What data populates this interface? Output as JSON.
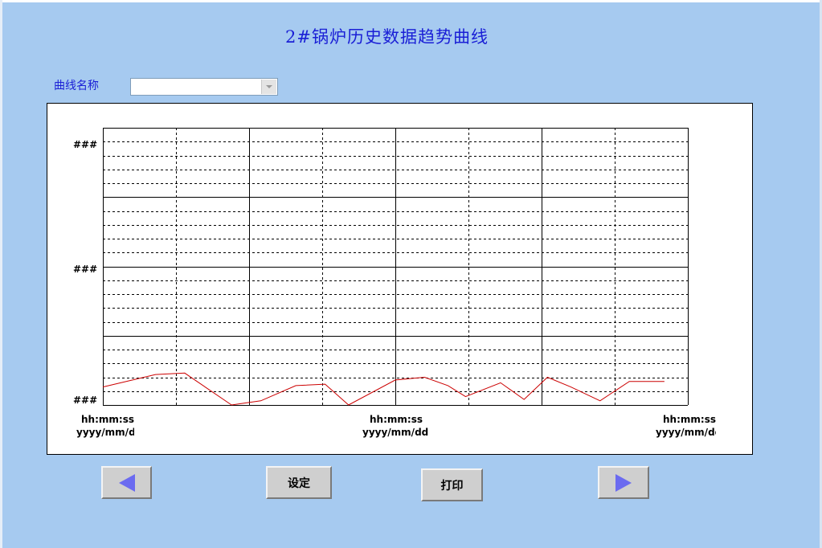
{
  "window": {
    "title": "2#锅炉历史数据趋势曲线"
  },
  "selector": {
    "label": "曲线名称",
    "value": ""
  },
  "chart": {
    "y_ticks": [
      "###",
      "###",
      "###"
    ],
    "x_ticks": [
      {
        "time": "hh:mm:ss",
        "date": "yyyy/mm/dd"
      },
      {
        "time": "hh:mm:ss",
        "date": "yyyy/mm/dd"
      },
      {
        "time": "hh:mm:ss",
        "date": "yyyy/mm/dd"
      }
    ],
    "line_color": "#cc0000"
  },
  "chart_data": {
    "type": "line",
    "title": "",
    "xlabel": "",
    "ylabel": "",
    "ylim": [
      0,
      1
    ],
    "xlim": [
      0,
      1
    ],
    "grid": true,
    "series": [
      {
        "color": "#cc0000",
        "x": [
          0.0,
          0.09,
          0.14,
          0.22,
          0.27,
          0.33,
          0.38,
          0.42,
          0.5,
          0.55,
          0.59,
          0.62,
          0.68,
          0.72,
          0.76,
          0.8,
          0.85,
          0.9,
          0.96
        ],
        "y": [
          0.065,
          0.11,
          0.115,
          0.0,
          0.015,
          0.07,
          0.075,
          0.0,
          0.09,
          0.1,
          0.07,
          0.03,
          0.08,
          0.02,
          0.1,
          0.065,
          0.015,
          0.085,
          0.085
        ]
      }
    ]
  },
  "buttons": {
    "prev": "previous-arrow",
    "settings": "设定",
    "print": "打印",
    "next": "next-arrow"
  }
}
